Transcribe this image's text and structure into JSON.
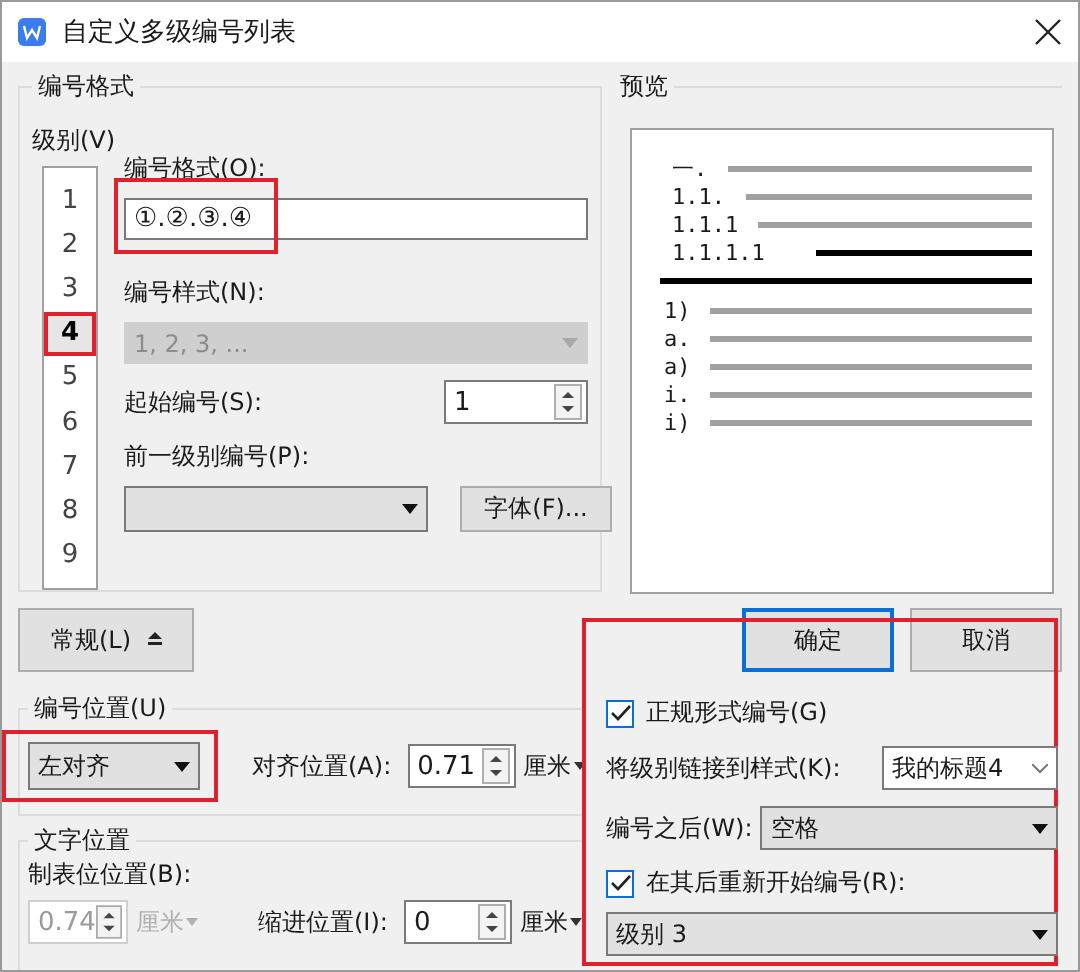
{
  "window": {
    "title": "自定义多级编号列表"
  },
  "number_format": {
    "heading": "编号格式",
    "level_label": "级别(V)",
    "levels": [
      {
        "label": "1",
        "selected": false,
        "highlighted": false
      },
      {
        "label": "2",
        "selected": false,
        "highlighted": false
      },
      {
        "label": "3",
        "selected": false,
        "highlighted": false
      },
      {
        "label": "4",
        "selected": true,
        "highlighted": true
      },
      {
        "label": "5",
        "selected": false,
        "highlighted": false
      },
      {
        "label": "6",
        "selected": false,
        "highlighted": false
      },
      {
        "label": "7",
        "selected": false,
        "highlighted": false
      },
      {
        "label": "8",
        "selected": false,
        "highlighted": false
      },
      {
        "label": "9",
        "selected": false,
        "highlighted": false
      }
    ],
    "format_label": "编号格式(O):",
    "format_value": "①.②.③.④",
    "format_highlighted": true,
    "style_label": "编号样式(N):",
    "style_value": "1, 2, 3, ...",
    "style_disabled": true,
    "start_label": "起始编号(S):",
    "start_value": "1",
    "previous_label": "前一级别编号(P):",
    "font_button": "字体(F)..."
  },
  "preview": {
    "heading": "预览",
    "rows": [
      {
        "label": "一.",
        "current": false
      },
      {
        "label": "1.1.",
        "current": false
      },
      {
        "label": "1.1.1",
        "current": false
      },
      {
        "label": "1.1.1.1",
        "current": true
      },
      {
        "label": "1)",
        "current": false
      },
      {
        "label": "a.",
        "current": false
      },
      {
        "label": "a)",
        "current": false
      },
      {
        "label": "i.",
        "current": false
      },
      {
        "label": "i)",
        "current": false
      }
    ]
  },
  "general_button": "常规(L)",
  "buttons": [
    {
      "label": "确定",
      "focused": true
    },
    {
      "label": "取消",
      "focused": false
    }
  ],
  "number_position": {
    "heading": "编号位置(U)",
    "alignment": "左对齐",
    "alignment_highlighted": true,
    "align_at_label": "对齐位置(A):",
    "align_at_value": "0.71",
    "unit": "厘米"
  },
  "text_position": {
    "heading": "文字位置",
    "tab_label": "制表位位置(B):",
    "tab_value": "0.74",
    "tab_unit": "厘米",
    "tab_disabled": true,
    "indent_label": "缩进位置(I):",
    "indent_value": "0",
    "unit": "厘米"
  },
  "options": {
    "highlighted": true,
    "legal_numbering": {
      "label": "正规形式编号(G)",
      "checked": true
    },
    "link_label": "将级别链接到样式(K):",
    "link_value": "我的标题4",
    "after_label": "编号之后(W):",
    "after_value": "空格",
    "restart": {
      "label": "在其后重新开始编号(R):",
      "checked": true
    },
    "restart_value": "级别 3"
  }
}
